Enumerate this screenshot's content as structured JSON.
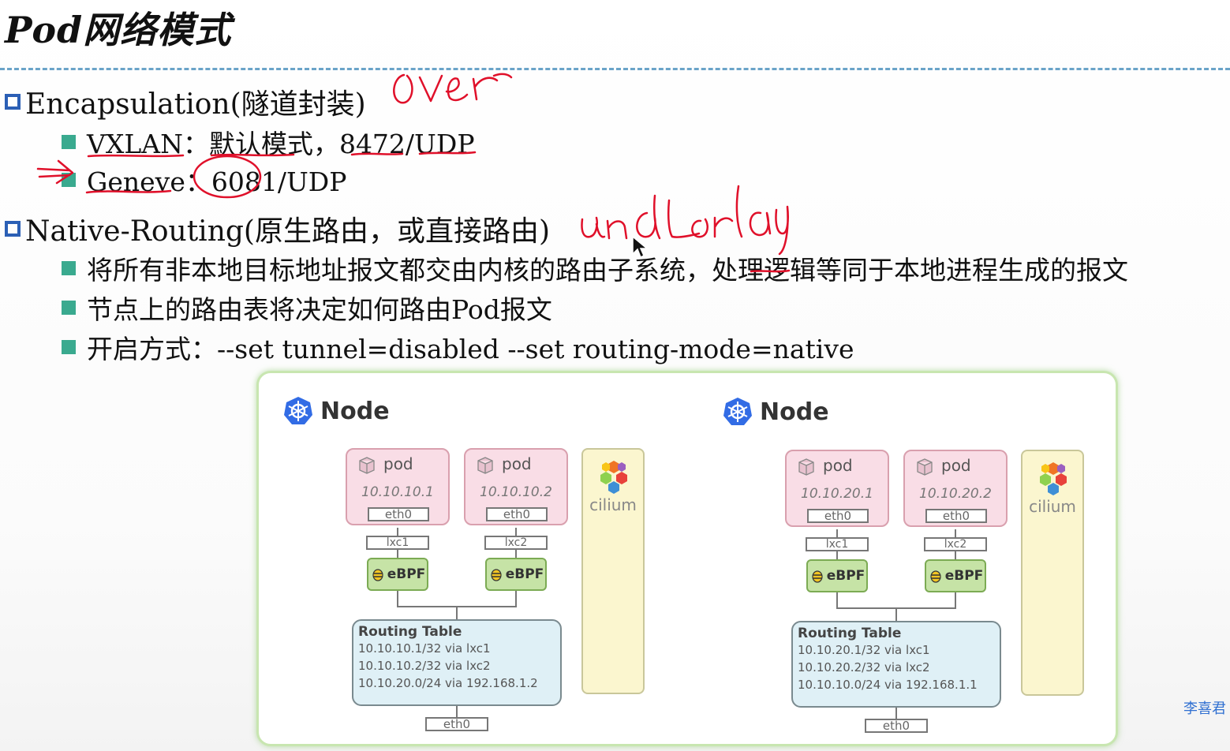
{
  "slide": {
    "title": "Pod网络模式",
    "sections": [
      {
        "label": "Encapsulation(隧道封装)",
        "items": [
          {
            "text": "VXLAN：默认模式，8472/UDP"
          },
          {
            "text": "Geneve：6081/UDP"
          }
        ]
      },
      {
        "label": "Native-Routing(原生路由，或直接路由)",
        "items": [
          {
            "text": "将所有非本地目标地址报文都交由内核的路由子系统，处理逻辑等同于本地进程生成的报文"
          },
          {
            "text": "节点上的路由表将决定如何路由Pod报文"
          },
          {
            "text": "开启方式：--set tunnel=disabled  --set routing-mode=native"
          }
        ]
      }
    ],
    "annotations": [
      "over",
      "underlay"
    ],
    "watermark": "李喜君"
  },
  "diagram": {
    "nodes": [
      {
        "title": "Node",
        "pods": [
          {
            "label": "pod",
            "ip": "10.10.10.1",
            "eth": "eth0",
            "lxc": "lxc1",
            "ebpf": "eBPF"
          },
          {
            "label": "pod",
            "ip": "10.10.10.2",
            "eth": "eth0",
            "lxc": "lxc2",
            "ebpf": "eBPF"
          }
        ],
        "cilium": "cilium",
        "routing_table": {
          "title": "Routing Table",
          "rows": [
            "10.10.10.1/32 via lxc1",
            "10.10.10.2/32 via lxc2",
            "10.10.20.0/24 via 192.168.1.2"
          ]
        },
        "eth": "eth0"
      },
      {
        "title": "Node",
        "pods": [
          {
            "label": "pod",
            "ip": "10.10.20.1",
            "eth": "eth0",
            "lxc": "lxc1",
            "ebpf": "eBPF"
          },
          {
            "label": "pod",
            "ip": "10.10.20.2",
            "eth": "eth0",
            "lxc": "lxc2",
            "ebpf": "eBPF"
          }
        ],
        "cilium": "cilium",
        "routing_table": {
          "title": "Routing Table",
          "rows": [
            "10.10.20.1/32 via lxc1",
            "10.10.20.2/32 via lxc2",
            "10.10.10.0/24 via 192.168.1.1"
          ]
        },
        "eth": "eth0"
      }
    ]
  },
  "colors": {
    "bullet_box": "#2b5fb5",
    "bullet_square": "#3aaa8f",
    "ink": "#e0102a",
    "divider": "#6aa3c8",
    "pod_fill": "#f9dde6",
    "ebpf_fill": "#c6e3a6",
    "cilium_fill": "#fbf6cf",
    "routing_fill": "#dff0f6",
    "watermark": "#2f6fd1"
  },
  "icons": [
    "kubernetes-icon",
    "pod-cube-icon",
    "ebpf-bee-icon",
    "cilium-logo-icon",
    "mouse-cursor-icon"
  ]
}
